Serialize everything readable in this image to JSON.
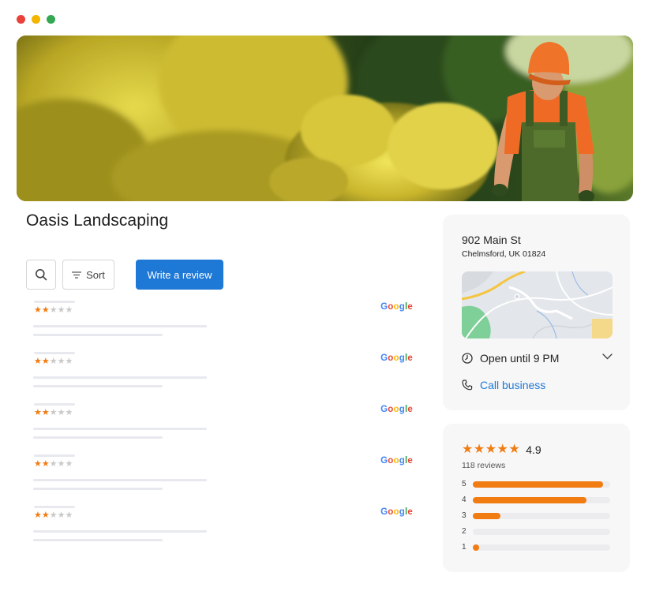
{
  "window": {
    "dot_colors": [
      "#e9423a",
      "#f4b400",
      "#34a853"
    ]
  },
  "business": {
    "name": "Oasis Landscaping"
  },
  "toolbar": {
    "search_icon": "search-icon",
    "sort_label": "Sort",
    "write_review_label": "Write a review"
  },
  "reviews": {
    "source_label": "Google",
    "items": [
      {
        "rating": 2,
        "max": 5
      },
      {
        "rating": 2,
        "max": 5
      },
      {
        "rating": 2,
        "max": 5
      },
      {
        "rating": 2,
        "max": 5
      },
      {
        "rating": 2,
        "max": 5
      }
    ]
  },
  "info": {
    "address_line1": "902 Main St",
    "address_line2": "Chelmsford, UK 01824",
    "hours": "Open until 9 PM",
    "call_label": "Call business"
  },
  "rating": {
    "average": "4.9",
    "stars": 5,
    "review_count": "118 reviews",
    "distribution": [
      {
        "label": "5",
        "fraction": 0.95
      },
      {
        "label": "4",
        "fraction": 0.83
      },
      {
        "label": "3",
        "fraction": 0.2
      },
      {
        "label": "2",
        "fraction": 0
      },
      {
        "label": "1",
        "fraction": 0.03
      }
    ]
  },
  "colors": {
    "accent": "#1e78d6",
    "star": "#f07c12",
    "google_blue": "#4285f4",
    "google_red": "#ea4335",
    "google_yellow": "#fbbc05",
    "google_green": "#34a853"
  }
}
